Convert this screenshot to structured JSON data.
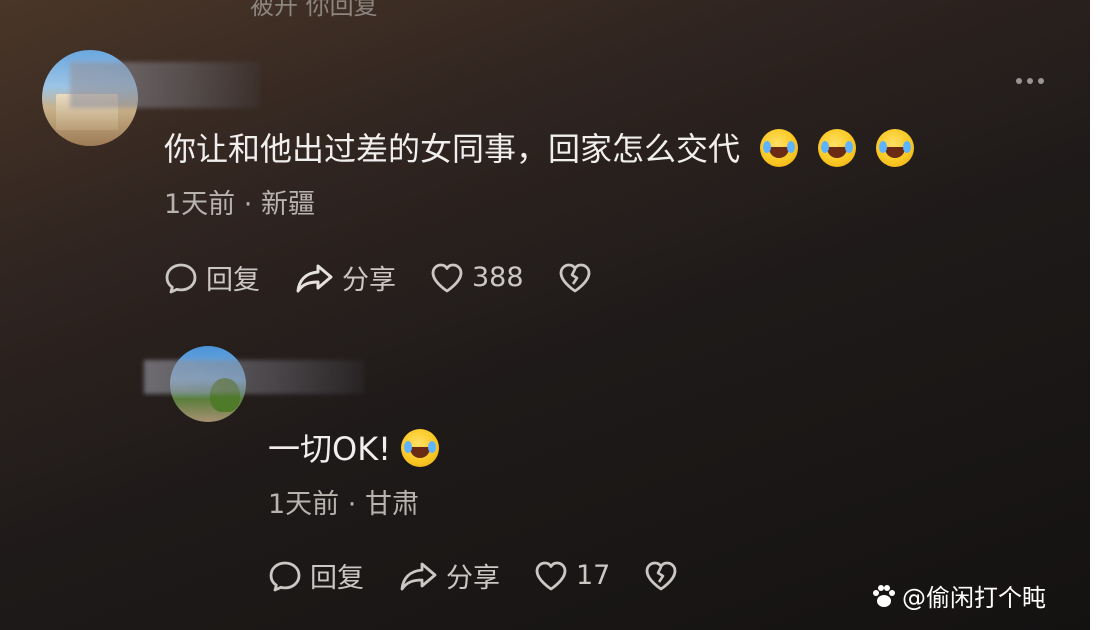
{
  "previous_comment": {
    "clipped_text": "被开 你回复"
  },
  "comments": [
    {
      "text": "你让和他出过差的女同事，回家怎么交代",
      "emoji_count": 3,
      "time": "1天前",
      "separator": "·",
      "location": "新疆",
      "actions": {
        "reply": "回复",
        "share": "分享",
        "likes": "388"
      }
    },
    {
      "text": "一切OK!",
      "emoji_count": 1,
      "time": "1天前",
      "separator": "·",
      "location": "甘肃",
      "actions": {
        "reply": "回复",
        "share": "分享",
        "likes": "17"
      }
    }
  ],
  "watermark": {
    "platform_icon": "paw-icon",
    "text": "@偷闲打个盹"
  },
  "colors": {
    "text_primary": "#f1efee",
    "text_secondary": "#b8b3af",
    "emoji": "#f9c823"
  }
}
